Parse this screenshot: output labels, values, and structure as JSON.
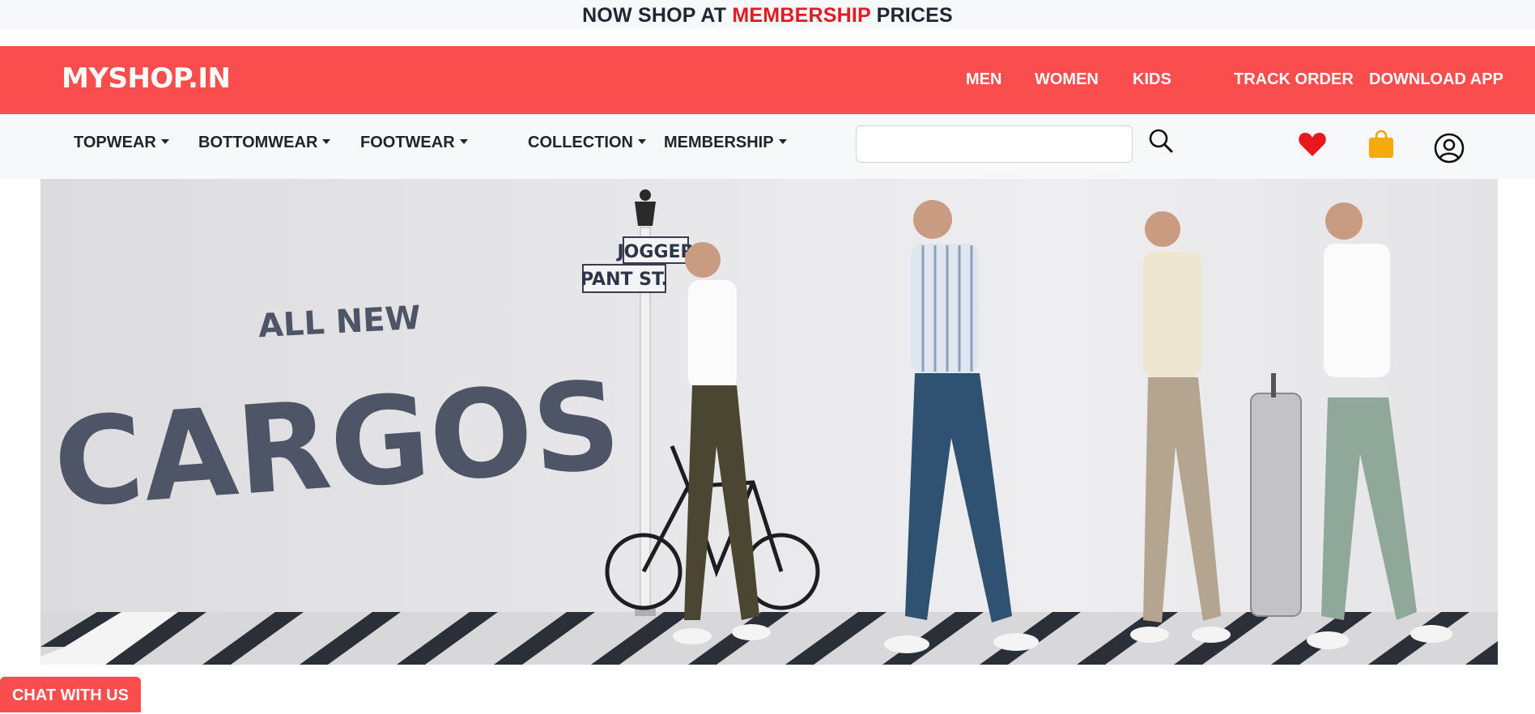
{
  "announcement": {
    "prefix": "NOW SHOP AT ",
    "highlight": "MEMBERSHIP",
    "suffix": " PRICES",
    "highlight_color": "#e11b22"
  },
  "header": {
    "logo": "MYSHOP.IN",
    "background": "#fa4d4d",
    "links": [
      "MEN",
      "WOMEN",
      "KIDS",
      "TRACK ORDER",
      "DOWNLOAD APP"
    ]
  },
  "nav": {
    "categories": [
      "TOPWEAR",
      "BOTTOMWEAR",
      "FOOTWEAR",
      "COLLECTION",
      "MEMBERSHIP"
    ],
    "search": {
      "placeholder": "",
      "value": ""
    },
    "icons": [
      "search-icon",
      "heart-icon",
      "shopping-bag-icon",
      "user-account-icon"
    ]
  },
  "hero": {
    "headline_small": "ALL NEW",
    "headline_big": "CARGOS",
    "sign_top": "JOGGER",
    "sign_bottom": "PANT ST."
  },
  "chat": {
    "label": "CHAT WITH US"
  }
}
